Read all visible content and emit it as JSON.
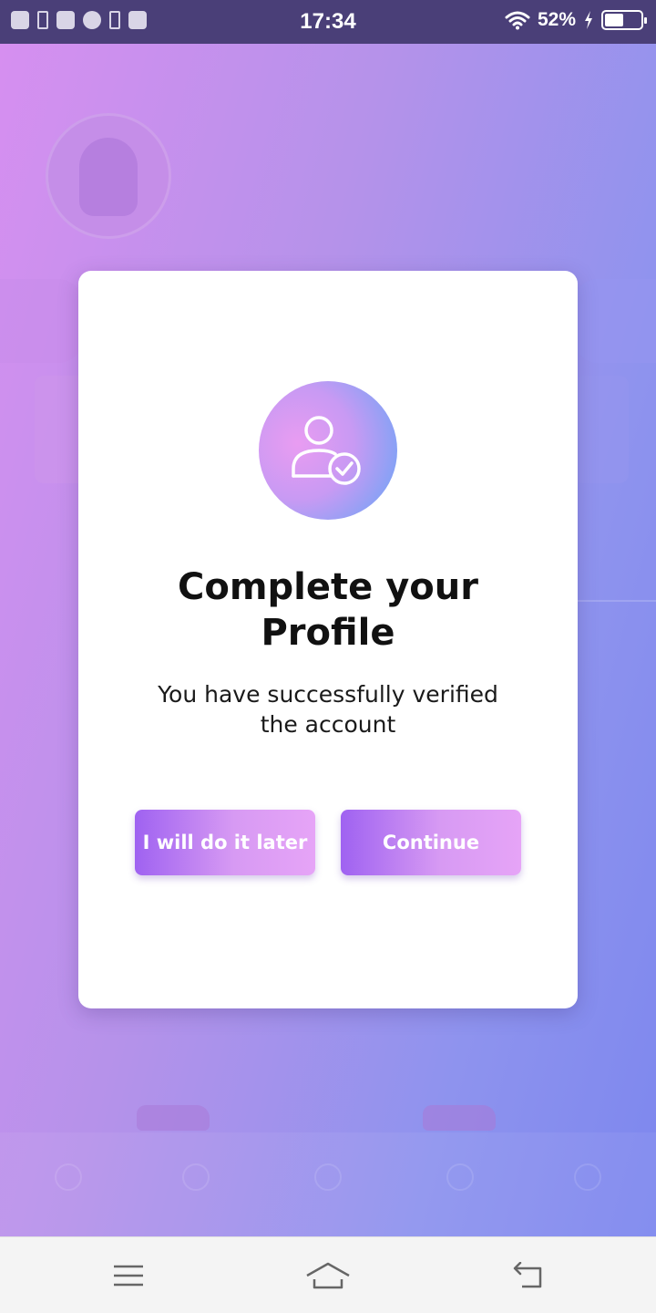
{
  "status_bar": {
    "time": "17:34",
    "battery_percent": "52%",
    "battery_level": 0.52,
    "icons_left": [
      "close-box-icon",
      "usb-icon",
      "app-icon",
      "speedometer-icon",
      "data-icon",
      "bag-icon"
    ],
    "icons_right": [
      "wifi-icon",
      "bolt-icon",
      "battery-icon"
    ]
  },
  "dialog": {
    "icon": "user-check-icon",
    "title": "Complete your Profile",
    "message": "You have successfully verified the account",
    "buttons": {
      "later": "I will do it later",
      "continue": "Continue"
    }
  },
  "nav_bar": {
    "icons": [
      "menu-icon",
      "home-icon",
      "back-icon"
    ]
  },
  "colors": {
    "status_bar": "#4a3f78",
    "button_gradient_start": "#9f62f1",
    "button_gradient_end": "#e6a4f7",
    "icon_gradient_start": "#e99cf2",
    "icon_gradient_end": "#5aa7f8",
    "background_start": "#d68ff0",
    "background_end": "#7d87ee"
  }
}
